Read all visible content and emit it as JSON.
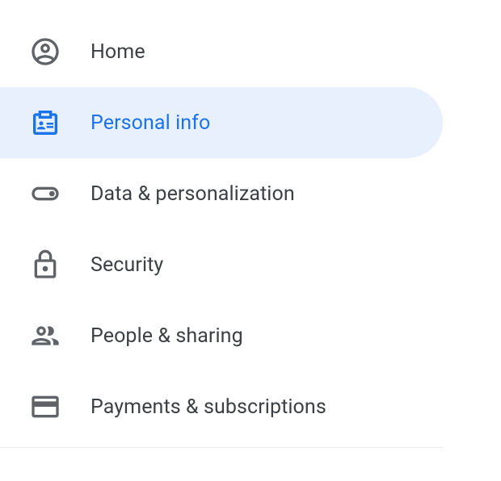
{
  "sidebar": {
    "items": [
      {
        "label": "Home"
      },
      {
        "label": "Personal info"
      },
      {
        "label": "Data & personalization"
      },
      {
        "label": "Security"
      },
      {
        "label": "People & sharing"
      },
      {
        "label": "Payments & subscriptions"
      }
    ],
    "activeIndex": 1
  }
}
